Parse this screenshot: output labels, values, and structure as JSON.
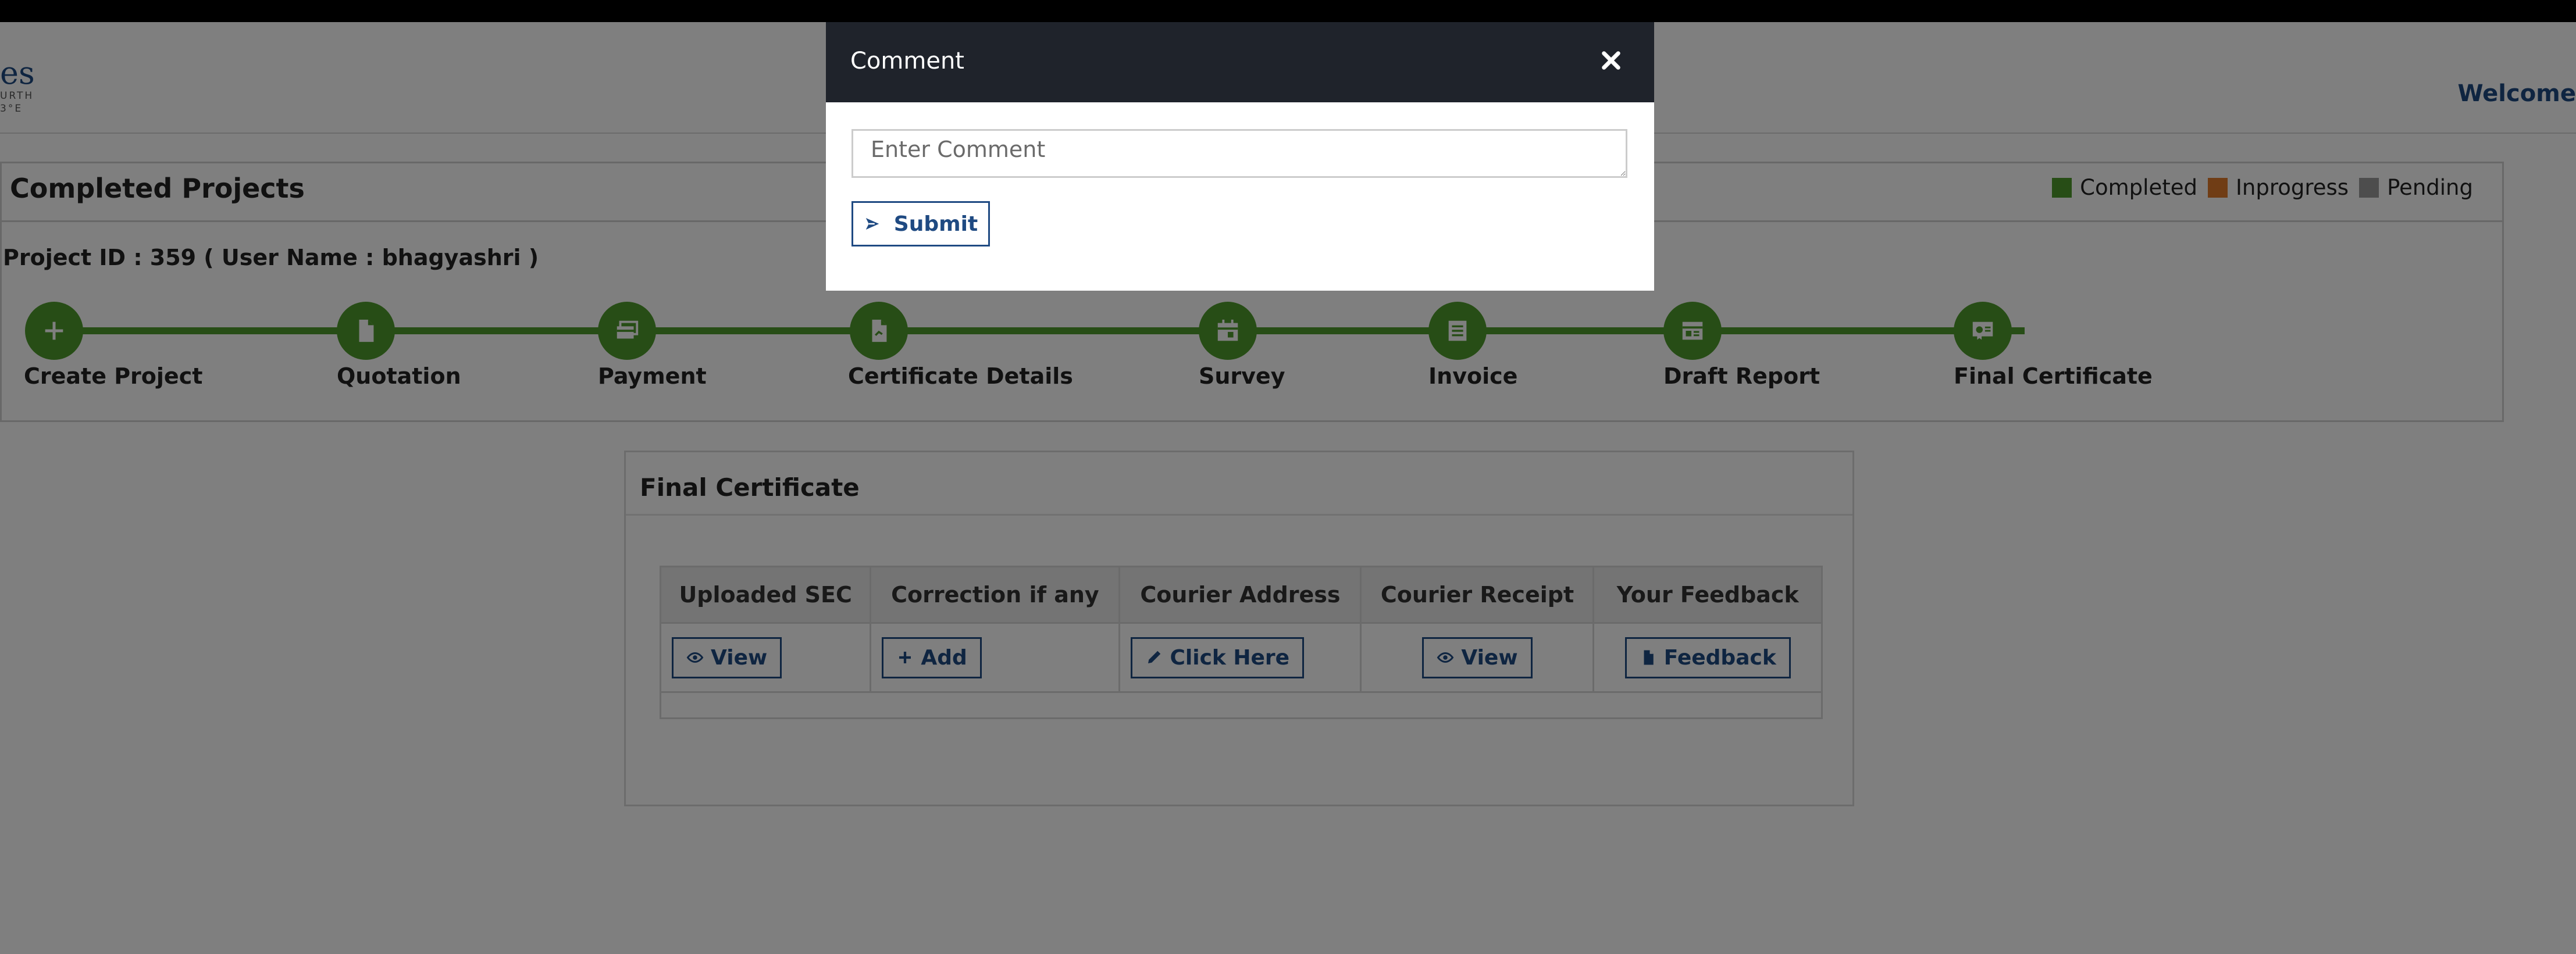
{
  "header": {
    "logo_text": "es",
    "logo_subtext_1": "URTH",
    "logo_subtext_2": "3°E",
    "welcome": "Welcome"
  },
  "panel": {
    "title": "Completed Projects",
    "project_info": "Project ID : 359 ( User Name : bhagyashri )",
    "legend": [
      {
        "label": "Completed",
        "color": "#4f9a2c"
      },
      {
        "label": "Inprogress",
        "color": "#e07b2a"
      },
      {
        "label": "Pending",
        "color": "#9a9a9a"
      }
    ],
    "steps": [
      {
        "label": "Create Project",
        "icon": "plus-icon",
        "status": "Completed"
      },
      {
        "label": "Quotation",
        "icon": "file-icon",
        "status": "Completed"
      },
      {
        "label": "Payment",
        "icon": "payment-icon",
        "status": "Completed"
      },
      {
        "label": "Certificate Details",
        "icon": "file-signature-icon",
        "status": "Completed"
      },
      {
        "label": "Survey",
        "icon": "calendar-icon",
        "status": "Completed"
      },
      {
        "label": "Invoice",
        "icon": "invoice-icon",
        "status": "Completed"
      },
      {
        "label": "Draft Report",
        "icon": "report-icon",
        "status": "Completed"
      },
      {
        "label": "Final Certificate",
        "icon": "certificate-icon",
        "status": "Completed"
      }
    ]
  },
  "certificate": {
    "title": "Final Certificate",
    "columns": [
      "Uploaded SEC",
      "Correction if any",
      "Courier Address",
      "Courier Receipt",
      "Your Feedback"
    ],
    "actions": [
      {
        "label": "View",
        "icon": "eye-icon"
      },
      {
        "label": "Add",
        "icon": "plus-icon"
      },
      {
        "label": "Click Here",
        "icon": "pencil-icon"
      },
      {
        "label": "View",
        "icon": "eye-icon"
      },
      {
        "label": "Feedback",
        "icon": "file-icon"
      }
    ]
  },
  "modal": {
    "title": "Comment",
    "close_icon": "close-icon",
    "comment_placeholder": "Enter Comment",
    "comment_value": "",
    "submit_label": "Submit",
    "submit_icon": "send-icon"
  },
  "colors": {
    "accent": "#1f4a82",
    "step_green": "#4f9a2c",
    "modal_header": "#1f232b"
  }
}
